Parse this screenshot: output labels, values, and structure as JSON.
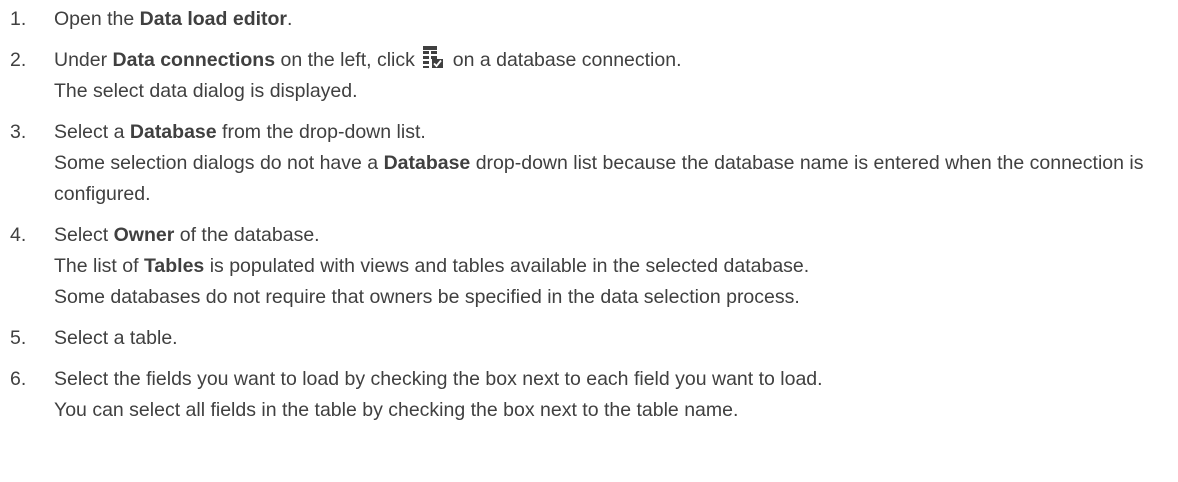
{
  "steps": [
    {
      "num": "1.",
      "line1": {
        "pre": "Open the ",
        "bold": "Data load editor",
        "post": "."
      }
    },
    {
      "num": "2.",
      "line1": {
        "pre": "Under ",
        "bold": "Data connections",
        "mid": " on the left, click ",
        "post": " on a database connection."
      },
      "icon": "select-data-table-icon",
      "line2": "The select data dialog is displayed."
    },
    {
      "num": "3.",
      "line1": {
        "pre": "Select a ",
        "bold": "Database",
        "post": " from the drop-down list."
      },
      "line2": {
        "pre": "Some selection dialogs do not have a ",
        "bold": "Database",
        "post": " drop-down list because the database name is entered when the connection is configured."
      }
    },
    {
      "num": "4.",
      "line1": {
        "pre": "Select ",
        "bold": "Owner",
        "post": " of the database."
      },
      "line2": {
        "pre": "The list of ",
        "bold": "Tables",
        "post": " is populated with views and tables available in the selected database."
      },
      "line3": "Some databases do not require that owners be specified in the data selection process."
    },
    {
      "num": "5.",
      "line1": "Select a table."
    },
    {
      "num": "6.",
      "line1": "Select the fields you want to load by checking the box next to each field you want to load.",
      "line2": "You can select all fields in the table by checking the box next to the table name."
    }
  ]
}
